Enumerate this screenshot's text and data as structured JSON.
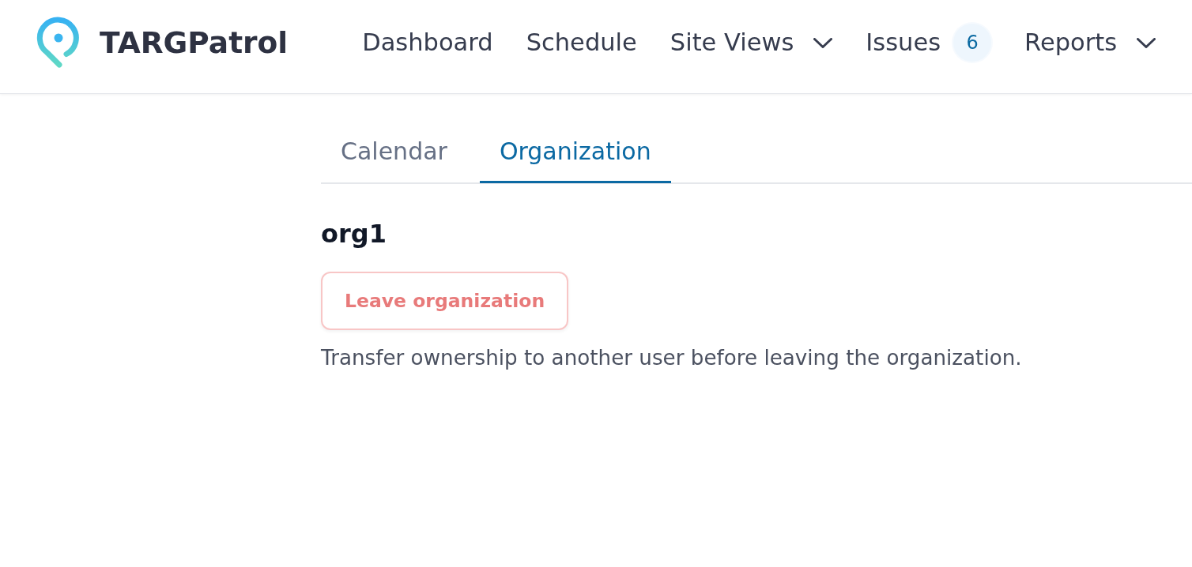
{
  "header": {
    "brand": "TARGPatrol",
    "nav": [
      {
        "label": "Dashboard",
        "kind": "link"
      },
      {
        "label": "Schedule",
        "kind": "link"
      },
      {
        "label": "Site Views",
        "kind": "menu"
      },
      {
        "label": "Issues",
        "kind": "count",
        "badge": "6"
      },
      {
        "label": "Reports",
        "kind": "menu"
      }
    ]
  },
  "tabs": [
    {
      "label": "Calendar",
      "selected": false
    },
    {
      "label": "Organization",
      "selected": true
    }
  ],
  "organization": {
    "name": "org1",
    "leave_button": {
      "label": "Leave organization",
      "disabled": true
    },
    "note": "Transfer ownership to another user before leaving the organization."
  }
}
